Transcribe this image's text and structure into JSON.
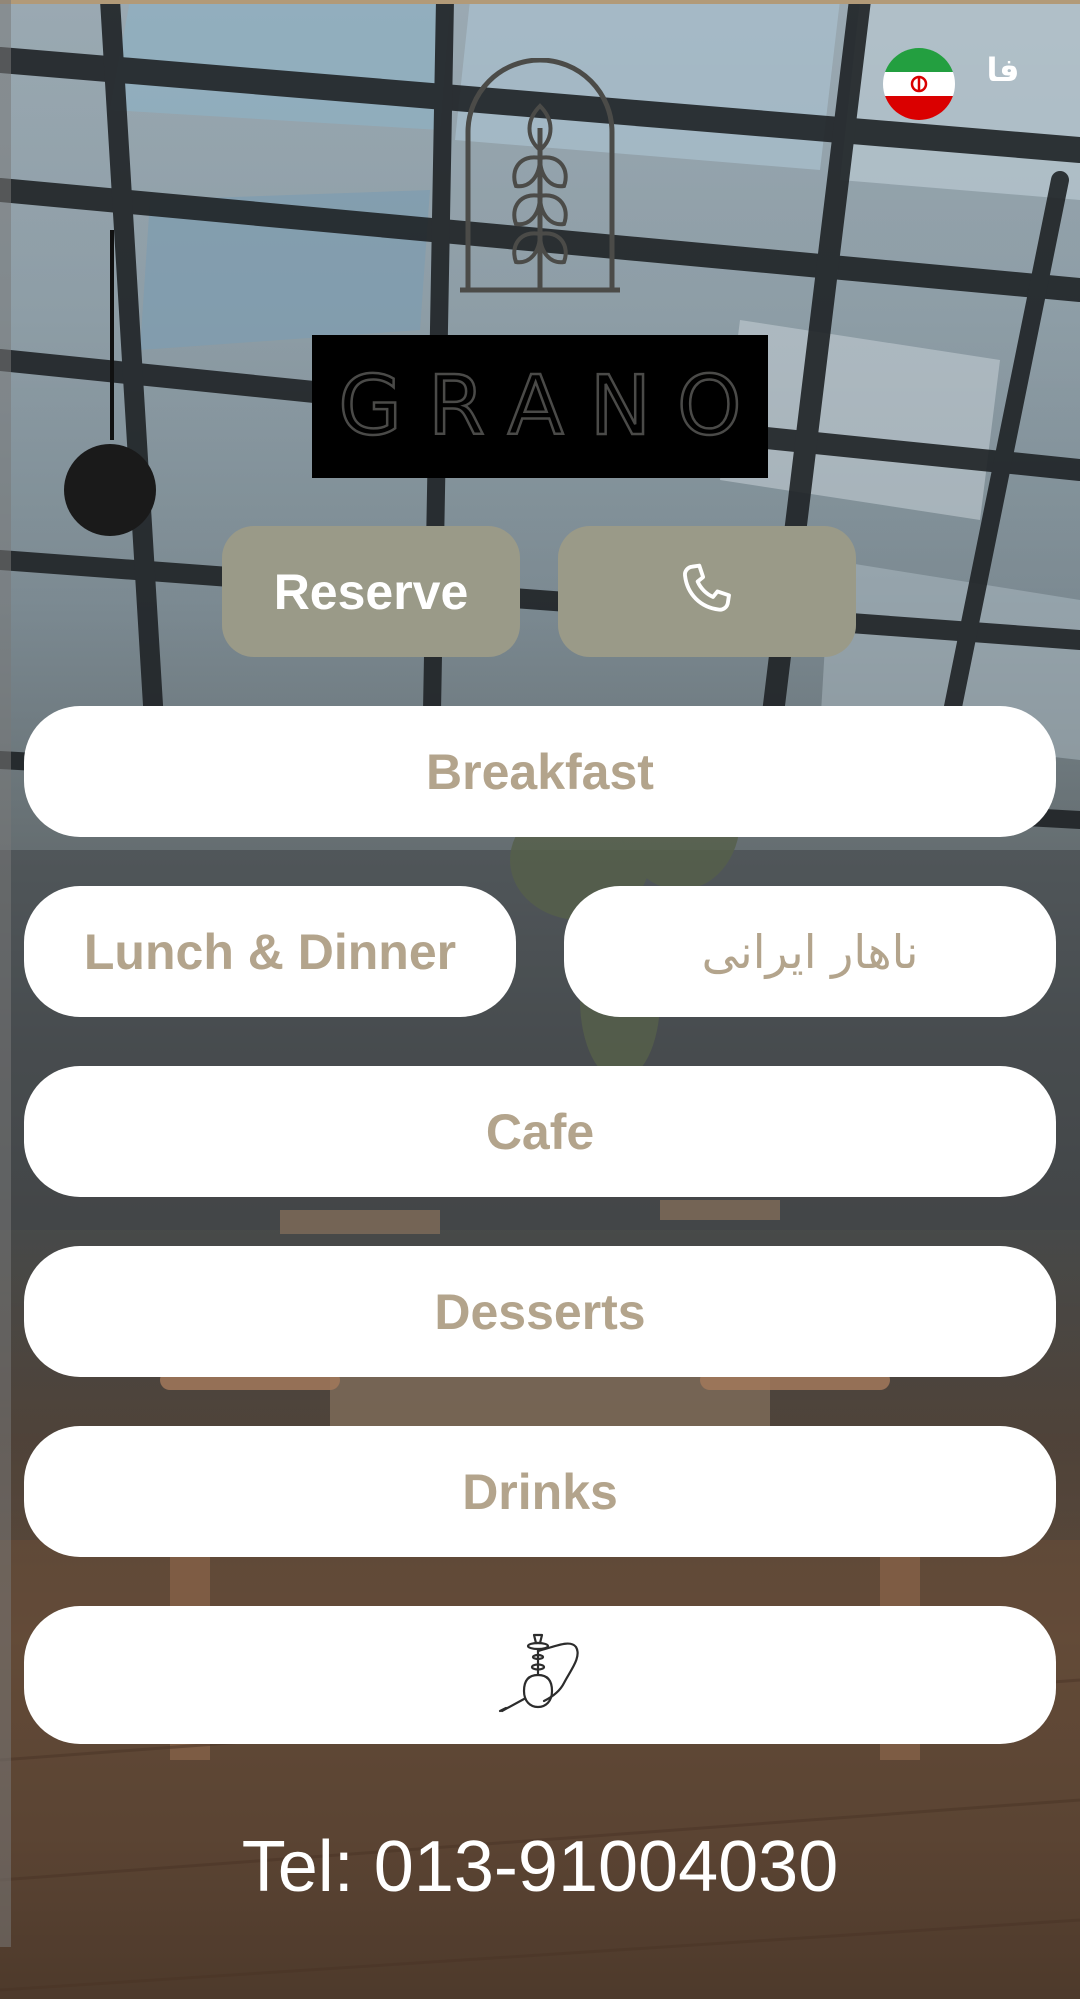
{
  "header": {
    "language_label": "فا",
    "language_icon": "iran-flag-icon",
    "brand_name": "GRANO",
    "logo_icon": "wheat-arch-logo-icon"
  },
  "actions": {
    "reserve_label": "Reserve",
    "call_icon": "phone-icon"
  },
  "menu": {
    "breakfast": "Breakfast",
    "lunch_dinner": "Lunch & Dinner",
    "persian_lunch": "ناهار ایرانی",
    "cafe": "Cafe",
    "desserts": "Desserts",
    "drinks": "Drinks",
    "hookah_icon": "hookah-icon"
  },
  "footer": {
    "tel": "Tel: 013-91004030"
  },
  "colors": {
    "accent": "#9a9a88",
    "menu_text": "#b3a48c",
    "top_strip": "#b29a78"
  }
}
